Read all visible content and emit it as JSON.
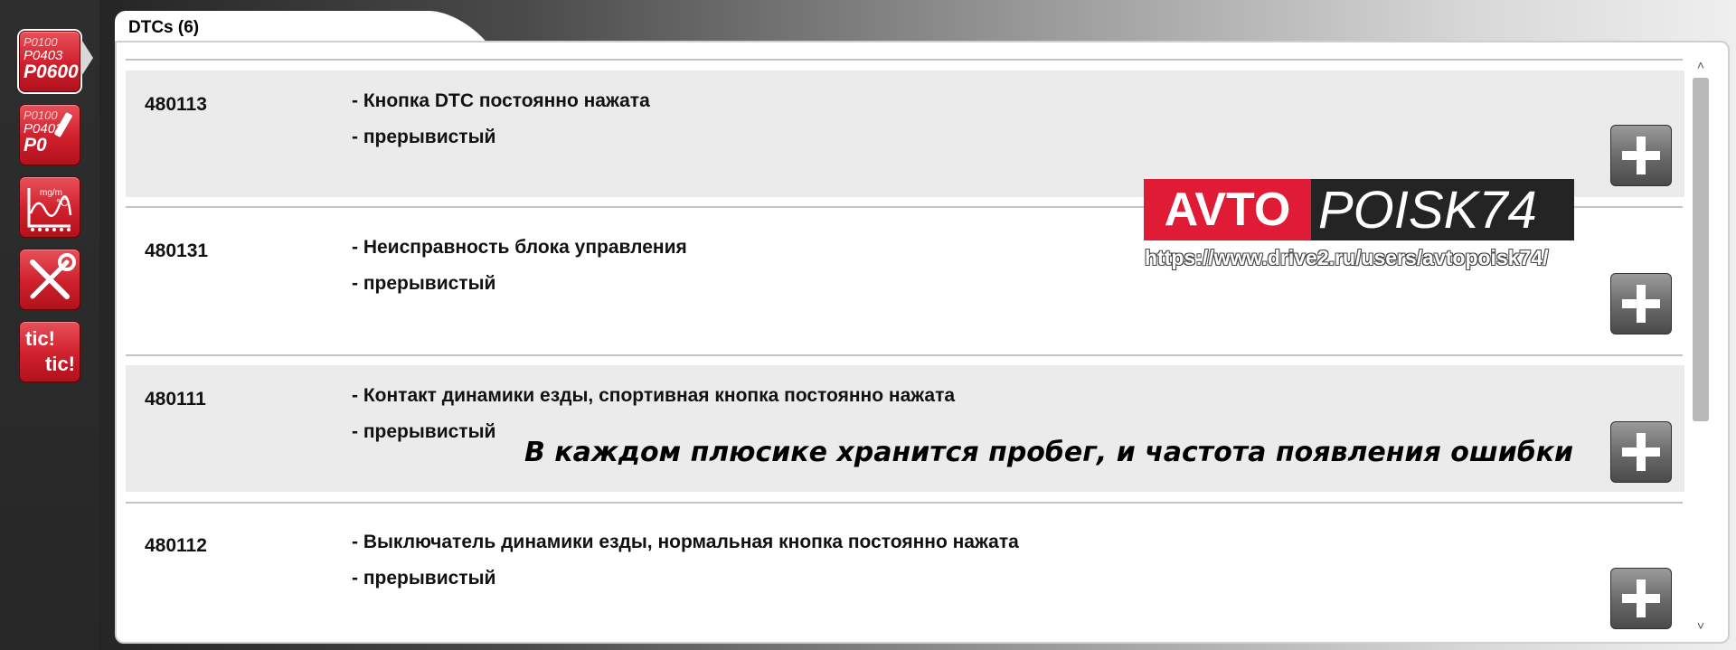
{
  "tab": {
    "title": "DTCs (6)"
  },
  "sidebar": {
    "items": [
      {
        "name": "dtc-list",
        "codes": [
          "P0100",
          "P0403",
          "P0600"
        ]
      },
      {
        "name": "dtc-clear",
        "codes": [
          "P0100",
          "P0403",
          "P0"
        ]
      },
      {
        "name": "live-data",
        "icon": "gauge-chart-icon"
      },
      {
        "name": "service-tools",
        "icon": "wrench-screwdriver-icon"
      },
      {
        "name": "tic-tic",
        "label1": "tic!",
        "label2": "tic!"
      }
    ]
  },
  "dtcs": [
    {
      "code": "480113",
      "description": "- Кнопка DTC постоянно нажата",
      "status": "- прерывистый"
    },
    {
      "code": "480131",
      "description": "- Неисправность блока управления",
      "status": "- прерывистый"
    },
    {
      "code": "480111",
      "description": "- Контакт динамики езды, спортивная кнопка постоянно нажата",
      "status": "- прерывистый"
    },
    {
      "code": "480112",
      "description": "- Выключатель динамики езды, нормальная кнопка постоянно нажата",
      "status": "- прерывистый"
    }
  ],
  "watermark": {
    "brand_left": "AVTO",
    "brand_right": "POISK74",
    "url": "https://www.drive2.ru/users/avtopoisk74/",
    "brand_red": "#e01b35"
  },
  "caption": "В каждом плюсике хранится пробег, и частота появления ошибки",
  "scrollbar": {
    "up_icon": "˄",
    "down_icon": "˅"
  },
  "plus_icon": "plus-icon"
}
